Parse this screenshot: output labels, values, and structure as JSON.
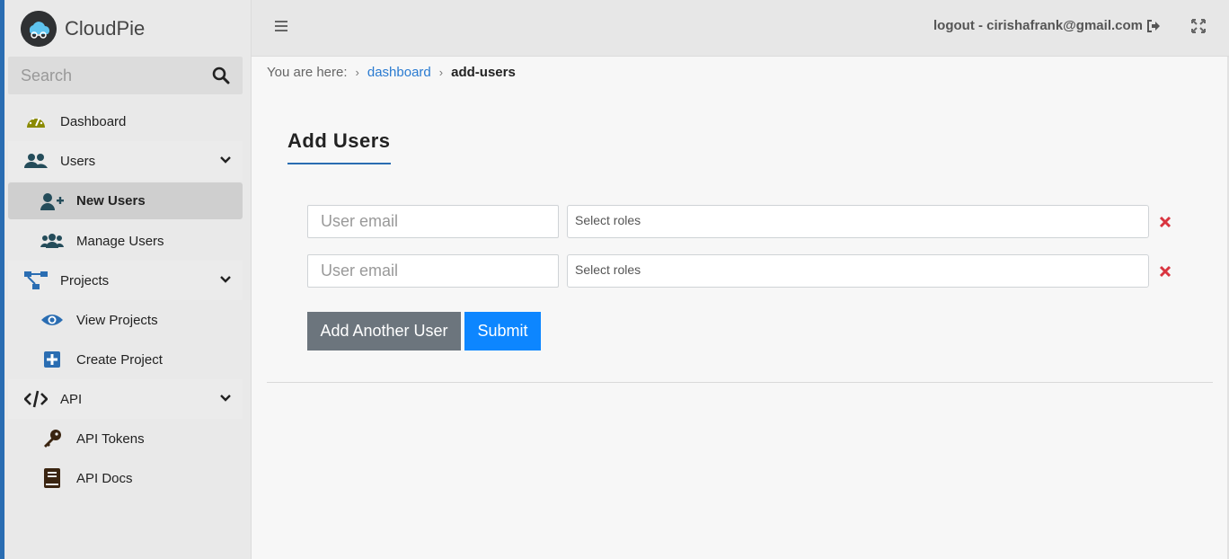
{
  "brand": {
    "name": "CloudPie"
  },
  "search": {
    "placeholder": "Search"
  },
  "sidebar": {
    "items": [
      {
        "label": "Dashboard",
        "icon": "dashboard-icon"
      },
      {
        "label": "Users",
        "icon": "users-icon",
        "expandable": true
      },
      {
        "label": "New Users",
        "icon": "user-plus-icon",
        "active": true
      },
      {
        "label": "Manage Users",
        "icon": "users-group-icon"
      },
      {
        "label": "Projects",
        "icon": "sitemap-icon",
        "expandable": true
      },
      {
        "label": "View Projects",
        "icon": "eye-icon"
      },
      {
        "label": "Create Project",
        "icon": "plus-square-icon"
      },
      {
        "label": "API",
        "icon": "code-icon",
        "expandable": true
      },
      {
        "label": "API Tokens",
        "icon": "key-icon"
      },
      {
        "label": "API Docs",
        "icon": "book-icon"
      }
    ]
  },
  "topbar": {
    "user_text": "logout - cirishafrank@gmail.com"
  },
  "breadcrumb": {
    "prefix": "You are here:",
    "link": "dashboard",
    "current": "add-users"
  },
  "page": {
    "title": "Add Users",
    "rows": [
      {
        "email_placeholder": "User email",
        "roles_placeholder": "Select roles"
      },
      {
        "email_placeholder": "User email",
        "roles_placeholder": "Select roles"
      }
    ],
    "add_button": "Add Another User",
    "submit_button": "Submit"
  },
  "colors": {
    "accent": "#2a6db2",
    "link": "#2a7bd1",
    "submit": "#0d86ff",
    "secondary": "#6c757d",
    "danger": "#d9343f"
  }
}
